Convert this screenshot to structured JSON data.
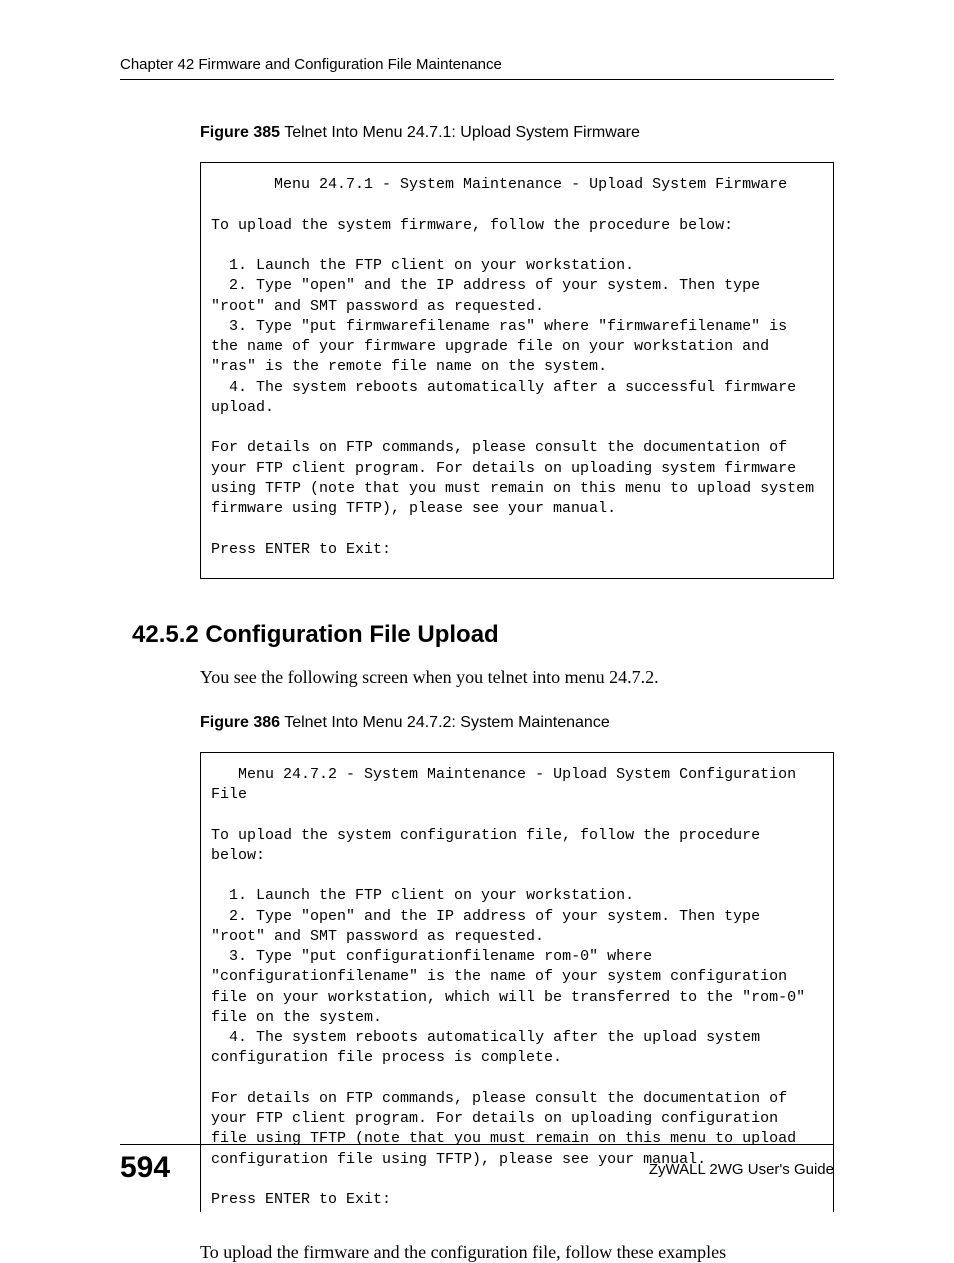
{
  "header": {
    "running": "Chapter 42 Firmware and Configuration File Maintenance"
  },
  "figure385": {
    "label_bold": "Figure 385",
    "label_rest": "   Telnet Into Menu 24.7.1: Upload System Firmware",
    "content": "       Menu 24.7.1 - System Maintenance - Upload System Firmware\n\nTo upload the system firmware, follow the procedure below:\n\n  1. Launch the FTP client on your workstation.\n  2. Type \"open\" and the IP address of your system. Then type \"root\" and SMT password as requested.\n  3. Type \"put firmwarefilename ras\" where \"firmwarefilename\" is the name of your firmware upgrade file on your workstation and \"ras\" is the remote file name on the system.\n  4. The system reboots automatically after a successful firmware upload.\n\nFor details on FTP commands, please consult the documentation of your FTP client program. For details on uploading system firmware using TFTP (note that you must remain on this menu to upload system firmware using TFTP), please see your manual.\n\nPress ENTER to Exit:"
  },
  "section": {
    "number_title": "42.5.2  Configuration File Upload",
    "intro": "You see the following screen when you telnet into menu 24.7.2."
  },
  "figure386": {
    "label_bold": "Figure 386",
    "label_rest": "   Telnet Into Menu 24.7.2: System Maintenance",
    "content": "   Menu 24.7.2 - System Maintenance - Upload System Configuration File\n\nTo upload the system configuration file, follow the procedure below:\n\n  1. Launch the FTP client on your workstation.\n  2. Type \"open\" and the IP address of your system. Then type \"root\" and SMT password as requested.\n  3. Type \"put configurationfilename rom-0\" where \"configurationfilename\" is the name of your system configuration file on your workstation, which will be transferred to the \"rom-0\" file on the system.\n  4. The system reboots automatically after the upload system configuration file process is complete.\n\nFor details on FTP commands, please consult the documentation of your FTP client program. For details on uploading configuration file using TFTP (note that you must remain on this menu to upload configuration file using TFTP), please see your manual.\n\nPress ENTER to Exit:"
  },
  "closing_text": "To upload the firmware and the configuration file, follow these examples",
  "footer": {
    "page": "594",
    "guide": "ZyWALL 2WG User's Guide"
  }
}
